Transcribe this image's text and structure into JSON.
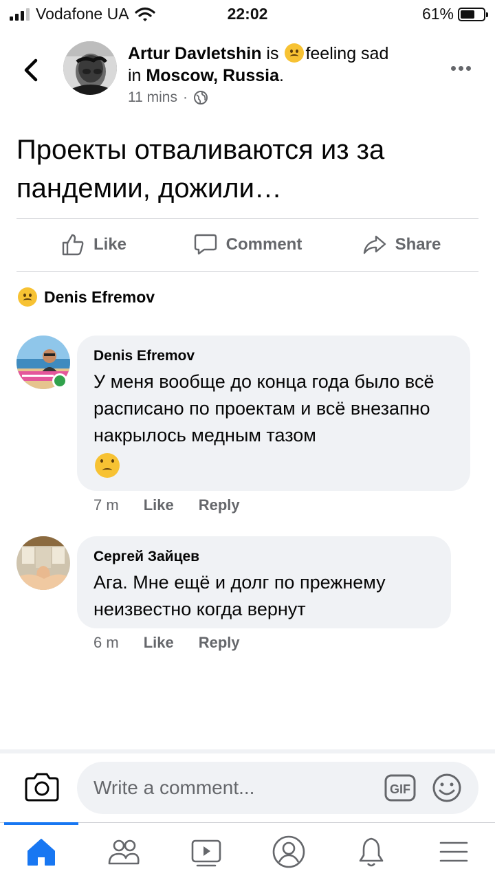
{
  "status_bar": {
    "carrier": "Vodafone UA",
    "time": "22:02",
    "battery": "61%",
    "battery_level": 0.61
  },
  "post": {
    "author": "Artur Davletshin",
    "is_text": " is ",
    "feeling": "feeling sad",
    "in_text": "in ",
    "location": "Moscow, Russia",
    "location_suffix": ".",
    "time": "11 mins",
    "separator": "·",
    "body": "Проекты отваливаются из за пандемии, дожили…"
  },
  "actions": {
    "like": "Like",
    "comment": "Comment",
    "share": "Share"
  },
  "reaction": {
    "name": "Denis Efremov"
  },
  "comments": [
    {
      "author": "Denis Efremov",
      "text": "У меня вообще до конца года было всё расписано по проектам и всё внезапно накрылось медным тазом",
      "time": "7 m",
      "like": "Like",
      "reply": "Reply"
    },
    {
      "author": "Сергей Зайцев",
      "text": "Ага. Мне ещё и долг по прежнему неизвестно когда вернут",
      "time": "6 m",
      "like": "Like",
      "reply": "Reply"
    }
  ],
  "composer": {
    "placeholder": "Write a comment..."
  },
  "colors": {
    "accent": "#1877f2",
    "secondary_text": "#65676b",
    "bubble": "#f0f2f5",
    "online": "#31a24c"
  },
  "tabs": [
    "home-icon",
    "groups-icon",
    "watch-icon",
    "profile-icon",
    "notifications-icon",
    "menu-icon"
  ]
}
